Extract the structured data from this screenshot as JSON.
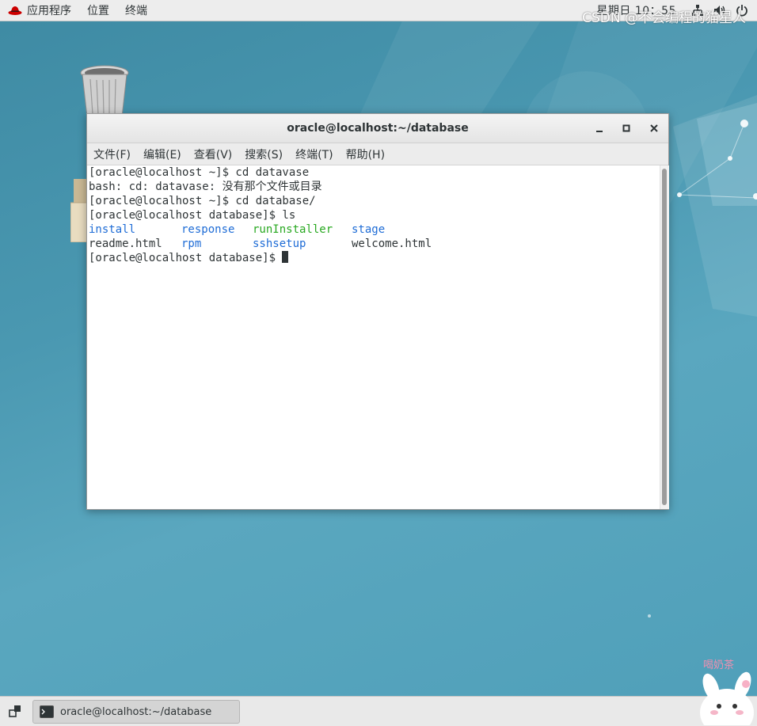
{
  "top_panel": {
    "menus": [
      "应用程序",
      "位置",
      "终端"
    ],
    "clock": "星期日 10：55"
  },
  "terminal": {
    "title": "oracle@localhost:~/database",
    "menu": [
      "文件(F)",
      "编辑(E)",
      "查看(V)",
      "搜索(S)",
      "终端(T)",
      "帮助(H)"
    ],
    "lines": [
      "[oracle@localhost ~]$ cd datavase",
      "bash: cd: datavase: 没有那个文件或目录",
      "[oracle@localhost ~]$ cd database/",
      "[oracle@localhost database]$ ls"
    ],
    "ls_row1": [
      "install",
      "response",
      "runInstaller",
      "stage"
    ],
    "ls_row2": [
      "readme.html",
      "rpm",
      "sshsetup",
      "welcome.html"
    ],
    "prompt": "[oracle@localhost database]$ "
  },
  "taskbar": {
    "item": "oracle@localhost:~/database"
  },
  "watermark": "CSDN @不会编程的猫星人",
  "mascot_text": "喝奶茶",
  "colors": {
    "dir": "#1e6cd6",
    "exec": "#28a820"
  }
}
